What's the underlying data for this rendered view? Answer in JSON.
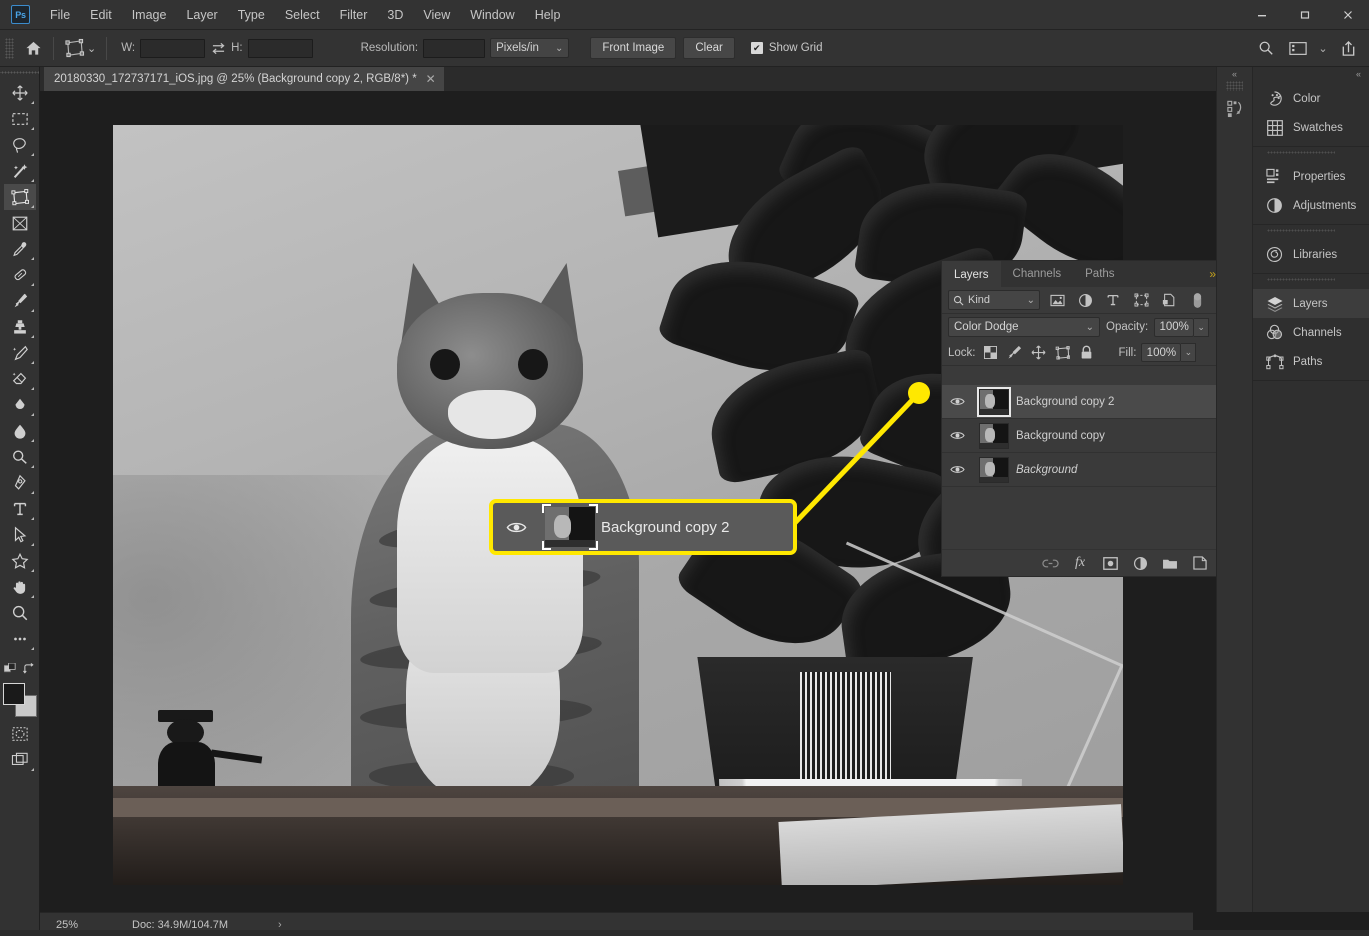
{
  "app": {
    "name": "Adobe Photoshop",
    "logo_text": "Ps"
  },
  "menubar": {
    "items": [
      "File",
      "Edit",
      "Image",
      "Layer",
      "Type",
      "Select",
      "Filter",
      "3D",
      "View",
      "Window",
      "Help"
    ]
  },
  "window_controls": {
    "minimize": "—",
    "maximize": "❑",
    "close": "✕"
  },
  "options_bar": {
    "home_icon": "home-icon",
    "tool_icon": "crop-tool-icon",
    "tool_dropdown_caret": "⌄",
    "width_label": "W:",
    "width_value": "",
    "swap_icon": "swap-arrows-icon",
    "height_label": "H:",
    "height_value": "",
    "resolution_label": "Resolution:",
    "resolution_value": "",
    "units_value": "Pixels/in",
    "units_caret": "⌄",
    "front_image_label": "Front Image",
    "clear_label": "Clear",
    "show_grid_label": "Show Grid",
    "show_grid_checked": true,
    "check_glyph": "✔",
    "right_icons": [
      "search-icon",
      "workspace-icon",
      "chevron-down-icon",
      "share-icon"
    ]
  },
  "document_tab": {
    "title": "20180330_172737171_iOS.jpg @ 25%  (Background copy 2, RGB/8*) *",
    "close_glyph": "✕",
    "grip_glyph": "»"
  },
  "toolbar": {
    "tools": [
      {
        "name": "move-tool",
        "label": "Move Tool",
        "has_corner": true,
        "active": false
      },
      {
        "name": "rectangular-marquee-tool",
        "label": "Rectangular Marquee Tool",
        "has_corner": true,
        "active": false
      },
      {
        "name": "lasso-tool",
        "label": "Lasso Tool",
        "has_corner": true,
        "active": false
      },
      {
        "name": "magic-wand-tool",
        "label": "Object Selection Tool",
        "has_corner": true,
        "active": false
      },
      {
        "name": "crop-tool",
        "label": "Crop Tool",
        "has_corner": true,
        "active": true
      },
      {
        "name": "frame-tool",
        "label": "Frame Tool",
        "has_corner": false,
        "active": false
      },
      {
        "name": "eyedropper-tool",
        "label": "Eyedropper Tool",
        "has_corner": true,
        "active": false
      },
      {
        "name": "spot-healing-brush-tool",
        "label": "Spot Healing Brush Tool",
        "has_corner": true,
        "active": false
      },
      {
        "name": "brush-tool",
        "label": "Brush Tool",
        "has_corner": true,
        "active": false
      },
      {
        "name": "clone-stamp-tool",
        "label": "Clone Stamp Tool",
        "has_corner": true,
        "active": false
      },
      {
        "name": "history-brush-tool",
        "label": "History Brush Tool",
        "has_corner": true,
        "active": false
      },
      {
        "name": "eraser-tool",
        "label": "Eraser Tool",
        "has_corner": true,
        "active": false
      },
      {
        "name": "gradient-tool",
        "label": "Gradient Tool",
        "has_corner": true,
        "active": false
      },
      {
        "name": "blur-tool",
        "label": "Blur Tool",
        "has_corner": true,
        "active": false
      },
      {
        "name": "dodge-tool",
        "label": "Dodge Tool",
        "has_corner": true,
        "active": false
      },
      {
        "name": "pen-tool",
        "label": "Pen Tool",
        "has_corner": true,
        "active": false
      },
      {
        "name": "type-tool",
        "label": "Horizontal Type Tool",
        "has_corner": true,
        "active": false
      },
      {
        "name": "path-selection-tool",
        "label": "Path Selection Tool",
        "has_corner": true,
        "active": false
      },
      {
        "name": "custom-shape-tool",
        "label": "Custom Shape Tool",
        "has_corner": true,
        "active": false
      },
      {
        "name": "hand-tool",
        "label": "Hand Tool",
        "has_corner": true,
        "active": false
      },
      {
        "name": "zoom-tool",
        "label": "Zoom Tool",
        "has_corner": false,
        "active": false
      },
      {
        "name": "edit-toolbar-ellipsis",
        "label": "Edit Toolbar",
        "has_corner": true,
        "active": false
      }
    ],
    "color_swatches": {
      "foreground": "#1a1a1a",
      "background": "#c9c9c9",
      "default_icon": "default-colors-icon",
      "swap_icon": "swap-colors-icon"
    },
    "quick_mask": "quick-mask-icon",
    "screen_mode": "screen-mode-icon"
  },
  "canvas": {
    "zoom": "25%",
    "background_color": "#1e1e1e",
    "artboard_color": "#9a9a9a"
  },
  "layers_panel": {
    "tabs": [
      {
        "label": "Layers",
        "active": true
      },
      {
        "label": "Channels",
        "active": false
      },
      {
        "label": "Paths",
        "active": false
      }
    ],
    "collapse_glyph": "»",
    "menu_icon": "panel-menu-icon",
    "filter": {
      "kind_label": "Kind",
      "search_icon": "search-icon",
      "caret": "⌄",
      "icons": [
        {
          "name": "filter-pixel-icon",
          "label": "Filter for pixel layers"
        },
        {
          "name": "filter-adjustment-icon",
          "label": "Filter for adjustment layers"
        },
        {
          "name": "filter-type-icon",
          "label": "Filter for type layers"
        },
        {
          "name": "filter-shape-icon",
          "label": "Filter for shape layers"
        },
        {
          "name": "filter-smart-object-icon",
          "label": "Filter for smart objects"
        },
        {
          "name": "filter-toggle-icon",
          "label": "Turn layer filtering on/off"
        }
      ]
    },
    "blend_mode": "Color Dodge",
    "blend_caret": "⌄",
    "opacity_label": "Opacity:",
    "opacity_value": "100%",
    "lock_label": "Lock:",
    "lock_icons": [
      {
        "name": "lock-transparent-pixels-icon",
        "label": "Lock transparent pixels"
      },
      {
        "name": "lock-image-pixels-icon",
        "label": "Lock image pixels"
      },
      {
        "name": "lock-position-icon",
        "label": "Lock position"
      },
      {
        "name": "lock-artboard-nesting-icon",
        "label": "Prevent auto-nesting"
      },
      {
        "name": "lock-all-icon",
        "label": "Lock all"
      }
    ],
    "fill_label": "Fill:",
    "fill_value": "100%",
    "stepper_caret": "⌄",
    "layers": [
      {
        "name": "Background copy 2",
        "visible": true,
        "selected": true,
        "locked": false,
        "italic": false,
        "thumb_framed": true
      },
      {
        "name": "Background copy",
        "visible": true,
        "selected": false,
        "locked": false,
        "italic": false,
        "thumb_framed": false
      },
      {
        "name": "Background",
        "visible": true,
        "selected": false,
        "locked": true,
        "italic": true,
        "thumb_framed": false
      }
    ],
    "lock_glyph": "🔒",
    "footer_icons": [
      {
        "name": "link-layers-icon",
        "label": "Link layers"
      },
      {
        "name": "layer-style-fx-icon",
        "label": "Add a layer style",
        "text": "fx"
      },
      {
        "name": "add-layer-mask-icon",
        "label": "Add layer mask"
      },
      {
        "name": "new-adjustment-layer-icon",
        "label": "Create new fill or adjustment layer"
      },
      {
        "name": "new-group-icon",
        "label": "Create a new group"
      },
      {
        "name": "new-layer-icon",
        "label": "Create a new layer"
      },
      {
        "name": "delete-layer-icon",
        "label": "Delete layer"
      }
    ]
  },
  "callout": {
    "layer_name": "Background copy 2",
    "border_color": "#ffe800",
    "background_color": "#5a5a5a",
    "eye_icon": "eye-visibility-icon",
    "pointer_dot_color": "#ffe800"
  },
  "collapsed_rail": {
    "collapse_glyph": "«",
    "icons": [
      {
        "name": "history-panel-icon",
        "label": "History"
      }
    ]
  },
  "dock": {
    "collapse_glyph": "«",
    "groups": [
      {
        "items": [
          {
            "name": "color-panel",
            "label": "Color",
            "icon": "color-wheel-icon",
            "active": false
          },
          {
            "name": "swatches-panel",
            "label": "Swatches",
            "icon": "swatches-grid-icon",
            "active": false
          }
        ]
      },
      {
        "items": [
          {
            "name": "properties-panel",
            "label": "Properties",
            "icon": "properties-icon",
            "active": false
          },
          {
            "name": "adjustments-panel",
            "label": "Adjustments",
            "icon": "adjustments-half-circle-icon",
            "active": false
          }
        ]
      },
      {
        "items": [
          {
            "name": "libraries-panel",
            "label": "Libraries",
            "icon": "libraries-cc-icon",
            "active": false
          }
        ]
      },
      {
        "items": [
          {
            "name": "layers-panel",
            "label": "Layers",
            "icon": "layers-stack-icon",
            "active": true
          },
          {
            "name": "channels-panel",
            "label": "Channels",
            "icon": "channels-circles-icon",
            "active": false
          },
          {
            "name": "paths-panel",
            "label": "Paths",
            "icon": "paths-anchor-icon",
            "active": false
          }
        ]
      }
    ]
  },
  "status_bar": {
    "zoom": "25%",
    "doc_info": "Doc: 34.9M/104.7M",
    "expand_glyph": "›"
  }
}
